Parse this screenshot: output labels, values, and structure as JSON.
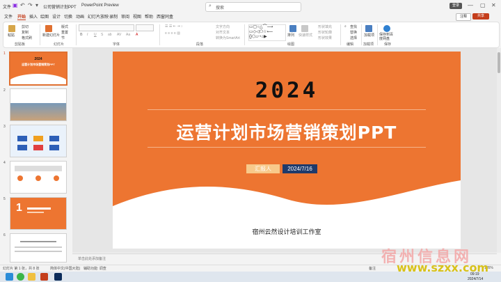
{
  "titlebar": {
    "app_label": "文件",
    "doc_title": "公司营销计划PPT",
    "app_name": "PowerPoint Preview",
    "search_placeholder": "搜索",
    "user": "登录"
  },
  "menu": {
    "items": [
      "文件",
      "开始",
      "插入",
      "绘图",
      "设计",
      "切换",
      "动画",
      "幻灯片放映",
      "录制",
      "审阅",
      "视图",
      "帮助",
      "西窗同盒"
    ],
    "active": "开始",
    "comment_label": "注释",
    "share_label": "共享"
  },
  "ribbon": {
    "groups": [
      {
        "label": "剪贴板",
        "buttons": [
          "粘贴",
          "剪切",
          "复制",
          "格式刷"
        ]
      },
      {
        "label": "幻灯片",
        "buttons": [
          "新建幻灯片",
          "版式",
          "重置",
          "节"
        ]
      },
      {
        "label": "字体",
        "buttons": [
          "B",
          "I",
          "U",
          "S",
          "ab",
          "AV",
          "Aa",
          "A"
        ]
      },
      {
        "label": "段落",
        "buttons": [
          "文字方向",
          "对齐文本",
          "转换为SmartArt"
        ]
      },
      {
        "label": "绘图",
        "buttons": [
          "排列",
          "快速样式",
          "形状填充",
          "形状轮廓",
          "形状效果"
        ]
      },
      {
        "label": "编辑",
        "buttons": [
          "查找",
          "替换",
          "选择"
        ]
      },
      {
        "label": "加载项",
        "buttons": [
          "加载项"
        ]
      },
      {
        "label": "保存",
        "buttons": [
          "保存到百度网盘"
        ]
      }
    ]
  },
  "thumbnails": [
    {
      "num": "1"
    },
    {
      "num": "2"
    },
    {
      "num": "3"
    },
    {
      "num": "4"
    },
    {
      "num": "5"
    },
    {
      "num": "6"
    }
  ],
  "slide": {
    "year": "2024",
    "title": "运营计划市场营销策划PPT",
    "reporter": "汇报人",
    "date": "2024/7/16",
    "studio": "宿州云然设计培训工作室",
    "colors": {
      "bg": "#ed7531",
      "wave": "#ffffff",
      "date_bg": "#1f3a6b",
      "reporter_bg": "#f8c98a"
    }
  },
  "notes_placeholder": "单击此处添加备注",
  "statusbar": {
    "slide_info": "幻灯片 第 1 张，共 8 张",
    "language": "简体中文(中国大陆)",
    "accessibility": "辅助功能: 调查",
    "notes": "备注",
    "zoom": "105%"
  },
  "taskbar": {
    "time": "09:19",
    "date": "2024/7/14"
  },
  "watermark": {
    "cn": "宿州信息网",
    "url": "www.szxx.com"
  }
}
